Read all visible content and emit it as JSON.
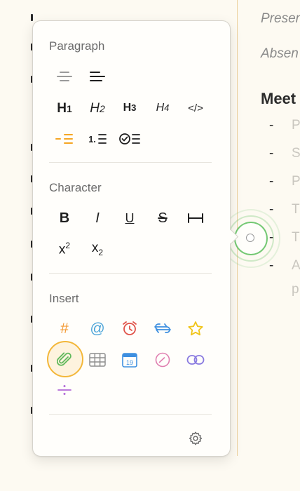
{
  "document": {
    "lines": [
      "Presen",
      "Absen"
    ],
    "heading": "Meet",
    "bullets": [
      "P",
      "S",
      "P",
      "T",
      "T",
      "A"
    ],
    "bullet_cont": "p"
  },
  "toolbar": {
    "paragraph": {
      "title": "Paragraph",
      "items": [
        {
          "name": "align-center",
          "glyph": "",
          "color": "#888888"
        },
        {
          "name": "align-left",
          "glyph": "",
          "color": "#1f1f1f"
        },
        {
          "name": "heading-1",
          "glyph": "H1",
          "color": "#1f1f1f"
        },
        {
          "name": "heading-2",
          "glyph": "H2",
          "color": "#1f1f1f"
        },
        {
          "name": "heading-3",
          "glyph": "H3",
          "color": "#1f1f1f"
        },
        {
          "name": "heading-4",
          "glyph": "H4",
          "color": "#1f1f1f"
        },
        {
          "name": "code-block",
          "glyph": "</>",
          "color": "#1f1f1f"
        },
        {
          "name": "bullet-list",
          "glyph": "",
          "color": "#f5a623"
        },
        {
          "name": "numbered-list",
          "glyph": "1.",
          "color": "#1f1f1f"
        },
        {
          "name": "checklist",
          "glyph": "",
          "color": "#1f1f1f"
        }
      ]
    },
    "character": {
      "title": "Character",
      "items": [
        {
          "name": "bold",
          "glyph": "B"
        },
        {
          "name": "italic",
          "glyph": "I"
        },
        {
          "name": "underline",
          "glyph": "U"
        },
        {
          "name": "strikethrough",
          "glyph": "S"
        },
        {
          "name": "inline-code",
          "glyph": "I—I"
        },
        {
          "name": "superscript",
          "glyph": "x",
          "script": "2"
        },
        {
          "name": "subscript",
          "glyph": "x",
          "script": "2"
        }
      ]
    },
    "insert": {
      "title": "Insert",
      "items": [
        {
          "name": "tag",
          "glyph": "#",
          "color": "#f39a34"
        },
        {
          "name": "mention",
          "glyph": "@",
          "color": "#4aa3d8"
        },
        {
          "name": "reminder",
          "glyph": "",
          "color": "#e0534a"
        },
        {
          "name": "link-note",
          "glyph": "",
          "color": "#3d8fe0"
        },
        {
          "name": "favorite",
          "glyph": "",
          "color": "#f0c419"
        },
        {
          "name": "attachment",
          "glyph": "",
          "color": "#5fb85a"
        },
        {
          "name": "table",
          "glyph": "",
          "color": "#8e8e8e"
        },
        {
          "name": "date",
          "glyph": "19",
          "color": "#3d8fe0"
        },
        {
          "name": "time",
          "glyph": "",
          "color": "#e07fb0"
        },
        {
          "name": "link",
          "glyph": "",
          "color": "#8a7be0"
        },
        {
          "name": "divider",
          "glyph": "",
          "color": "#b36ad8"
        }
      ]
    },
    "settings_icon": "gear-icon"
  }
}
